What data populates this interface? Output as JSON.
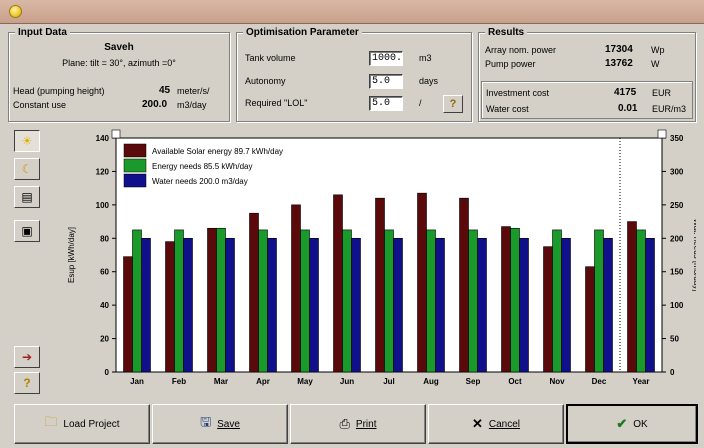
{
  "input_data": {
    "title": "Input Data",
    "site": "Saveh",
    "plane": "Plane: tilt = 30°, azimuth =0°",
    "head_label": "Head (pumping height)",
    "head_value": "45",
    "head_unit": "meter/s/",
    "use_label": "Constant use",
    "use_value": "200.0",
    "use_unit": "m3/day"
  },
  "optimisation": {
    "title": "Optimisation Parameter",
    "tank_label": "Tank volume",
    "tank_value": "1000.",
    "tank_unit": "m3",
    "autonomy_label": "Autonomy",
    "autonomy_value": "5.0",
    "autonomy_unit": "days",
    "lol_label": "Required \"LOL\"",
    "lol_value": "5.0",
    "lol_unit": "/",
    "help_label": "?"
  },
  "results": {
    "title": "Results",
    "array_label": "Array nom. power",
    "array_value": "17304",
    "array_unit": "Wp",
    "pump_label": "Pump power",
    "pump_value": "13762",
    "pump_unit": "W",
    "invest_label": "Investment cost",
    "invest_value": "4175",
    "invest_unit": "EUR",
    "water_label": "Water cost",
    "water_value": "0.01",
    "water_unit": "EUR/m3"
  },
  "side_toolbar": [
    {
      "icon": "sun-icon"
    },
    {
      "icon": "moon-icon"
    },
    {
      "icon": "table-icon"
    },
    {
      "icon": "print-preview-icon"
    },
    {
      "icon": "export-icon"
    },
    {
      "icon": "help-icon"
    }
  ],
  "chart_data": {
    "type": "bar",
    "categories": [
      "Jan",
      "Feb",
      "Mar",
      "Apr",
      "May",
      "Jun",
      "Jul",
      "Aug",
      "Sep",
      "Oct",
      "Nov",
      "Dec",
      "Year"
    ],
    "series": [
      {
        "name": "Available Solar energy  89.7 kWh/day",
        "color": "#5a0a0a",
        "values": [
          69,
          78,
          86,
          95,
          100,
          106,
          104,
          107,
          104,
          87,
          75,
          63,
          90
        ]
      },
      {
        "name": "Energy needs  85.5 kWh/day",
        "color": "#1a9a2a",
        "values": [
          85,
          85,
          86,
          85,
          85,
          85,
          85,
          85,
          85,
          86,
          85,
          85,
          85
        ]
      },
      {
        "name": "Water needs  200.0 m3/day",
        "color": "#10108a",
        "values": [
          80,
          80,
          80,
          80,
          80,
          80,
          80,
          80,
          80,
          80,
          80,
          80,
          80
        ]
      }
    ],
    "ylabel": "Esup [kWh/day]",
    "y2label": "Wat. needs [m3/day]",
    "ylim": [
      0,
      140
    ],
    "y2lim": [
      0,
      350
    ],
    "yticks": [
      "0",
      "20",
      "40",
      "60",
      "80",
      "100",
      "120",
      "140"
    ],
    "y2ticks": [
      "0",
      "50",
      "100",
      "150",
      "200",
      "250",
      "300",
      "350"
    ],
    "legend_position": "top-left"
  },
  "buttons": {
    "load": "Load Project",
    "save": "Save",
    "print": "Print",
    "cancel": "Cancel",
    "ok": "OK"
  }
}
